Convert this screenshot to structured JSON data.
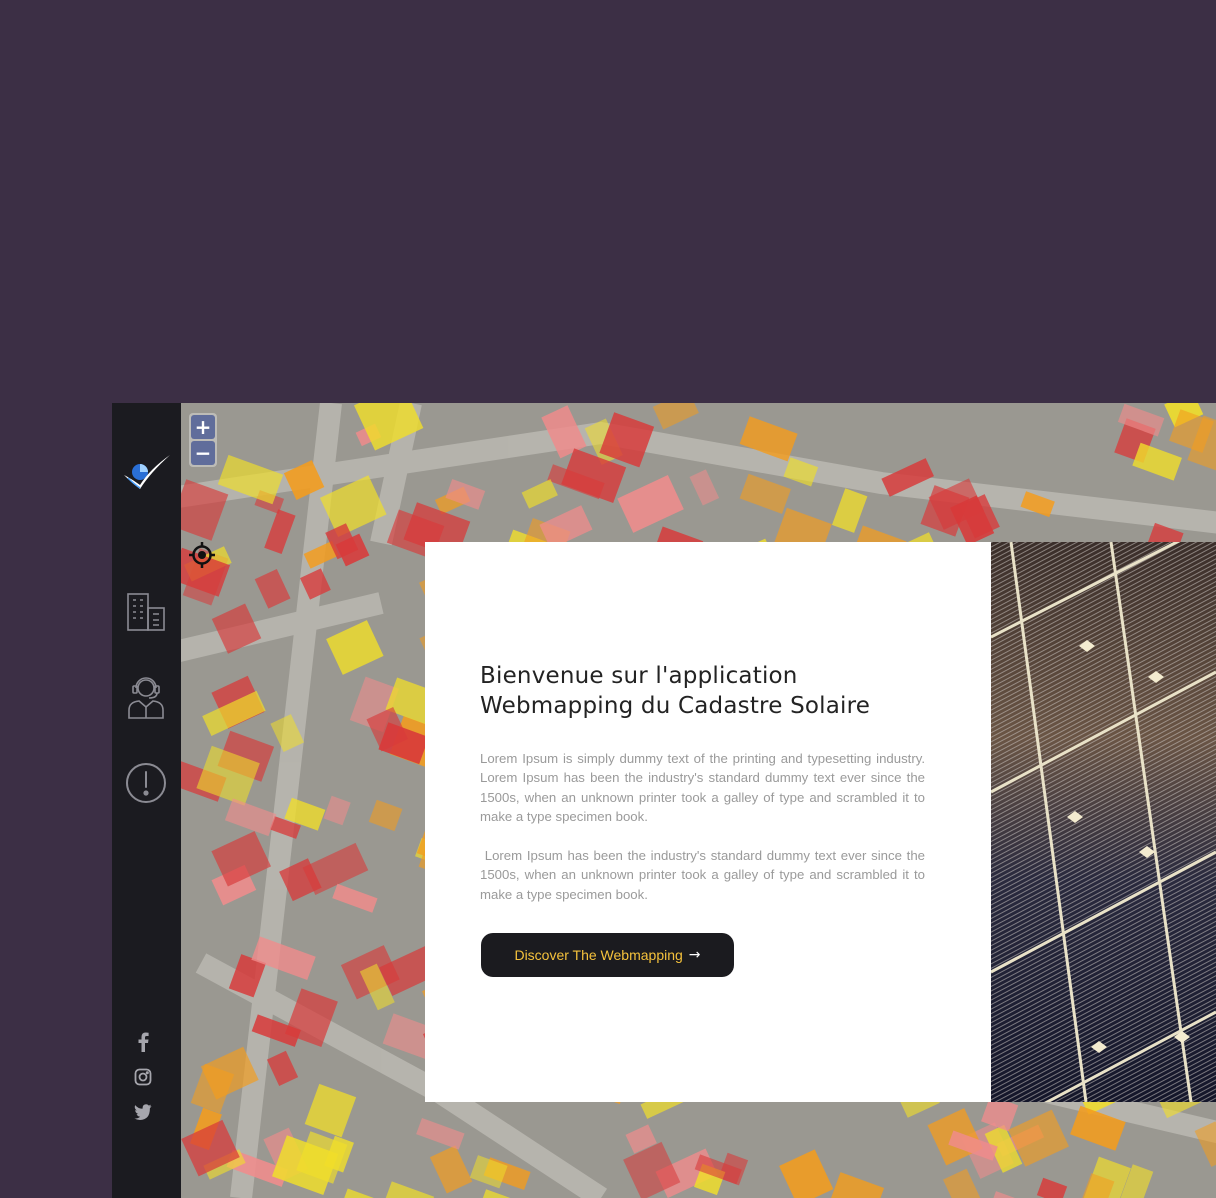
{
  "welcome": {
    "title_line1": "Bienvenue sur l'application",
    "title_line2": "Webmapping du Cadastre Solaire",
    "paragraph1": "Lorem Ipsum is simply dummy text of the printing and typesetting industry. Lorem Ipsum has been the industry's standard dummy text ever since the 1500s, when an unknown printer took a galley of type and scrambled it to make a type specimen book.",
    "paragraph2": " Lorem Ipsum has been the industry's standard dummy text ever since the 1500s, when an unknown printer took a galley of type and scrambled it to make a type specimen book.",
    "cta_label": "Discover The Webmapping",
    "cta_arrow": "→"
  },
  "map": {
    "zoom_in_label": "+",
    "zoom_out_label": "−"
  },
  "sidebar": {
    "items": [
      {
        "icon": "building-icon"
      },
      {
        "icon": "support-agent-icon"
      },
      {
        "icon": "alert-icon"
      }
    ],
    "social": [
      {
        "icon": "facebook-icon"
      },
      {
        "icon": "instagram-icon"
      },
      {
        "icon": "twitter-icon"
      }
    ]
  },
  "colors": {
    "page_background": "#3c2f45",
    "sidebar": "#1b1b20",
    "cta_background": "#1b1b1f",
    "cta_text": "#f5c23c",
    "roof_red": "#d83a3a",
    "roof_orange": "#f39c1e",
    "roof_yellow": "#f0de2a",
    "roof_pink": "#f08c8c"
  }
}
